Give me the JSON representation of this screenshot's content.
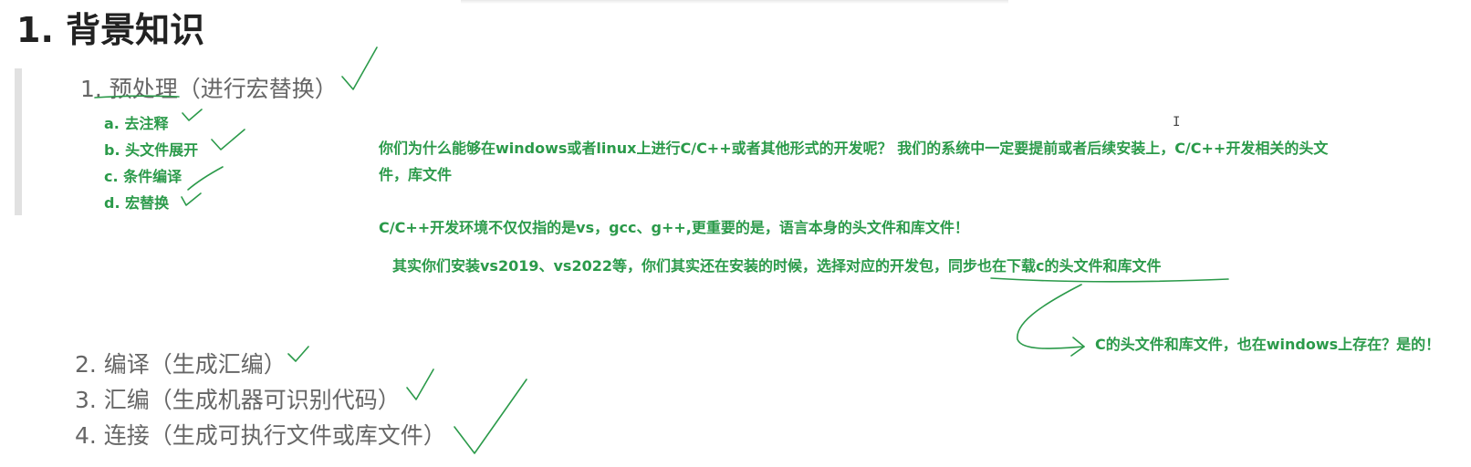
{
  "heading": "1. 背景知识",
  "steps": [
    {
      "label": "1. 预处理（进行宏替换）"
    },
    {
      "label": "2. 编译（生成汇编）"
    },
    {
      "label": "3. 汇编（生成机器可识别代码）"
    },
    {
      "label": "4. 连接（生成可执行文件或库文件）"
    }
  ],
  "substeps": [
    {
      "label": "a. 去注释"
    },
    {
      "label": "b. 头文件展开"
    },
    {
      "label": "c. 条件编译"
    },
    {
      "label": "d. 宏替换"
    }
  ],
  "notes": {
    "line1": "你们为什么能够在windows或者linux上进行C/C++或者其他形式的开发呢？ 我们的系统中一定要提前或者后续安装上，C/C++开发相关的头文",
    "line2": "件，库文件",
    "line3": "C/C++开发环境不仅仅指的是vs，gcc、g++,更重要的是，语言本身的头文件和库文件！",
    "line4": "其实你们安装vs2019、vs2022等，你们其实还在安装的时候，选择对应的开发包，同步也在下载c的头文件和库文件",
    "line5": "C的头文件和库文件，也在windows上存在？是的！"
  },
  "cursor": "I",
  "colors": {
    "annotation": "#2b9a4a",
    "step_text": "#666666",
    "heading": "#222222"
  }
}
